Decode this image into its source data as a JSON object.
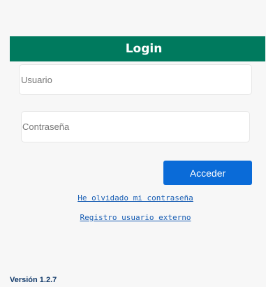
{
  "login": {
    "title": "Login",
    "user_placeholder": "Usuario",
    "password_placeholder": "Contraseña",
    "submit_label": "Acceder",
    "forgot_password_link": "He olvidado mi contraseña",
    "register_link": "Registro usuario externo"
  },
  "footer": {
    "version": "Versión 1.2.7"
  },
  "colors": {
    "header": "#007a5e",
    "button": "#0a6bd8",
    "link": "#1a5fb4",
    "background": "#f7f7f7"
  }
}
